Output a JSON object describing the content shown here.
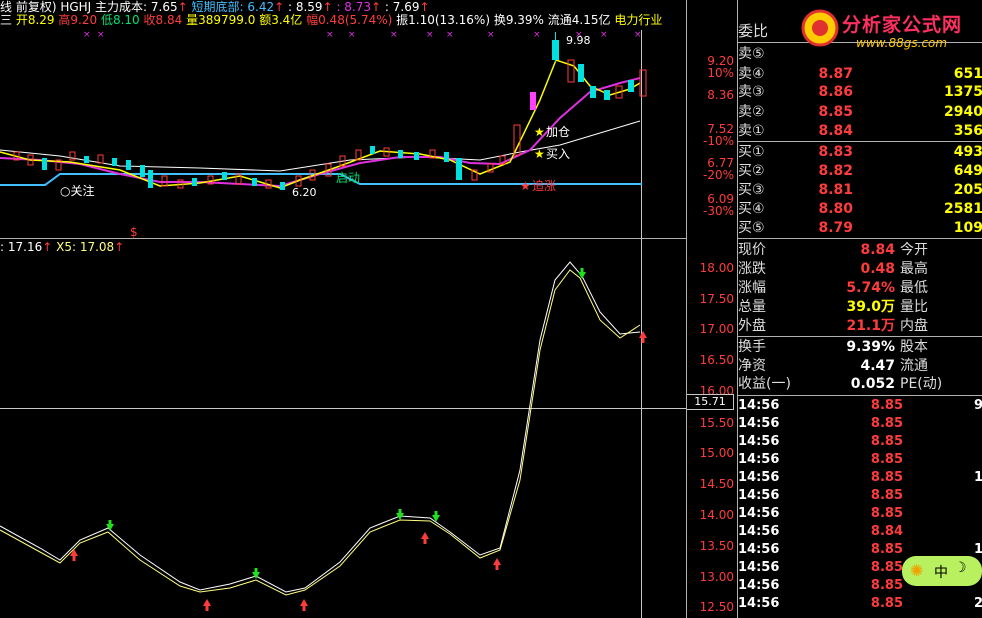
{
  "header": {
    "line1": {
      "mode": "线 前复权)",
      "code": "HGHJ",
      "cost_label": "主力成本: 7.65",
      "cost_arrow": "↑",
      "bottom_label": "短期底部: 6.42",
      "bottom_arrow": "↑",
      "v1": ": 8.59",
      "v1_arrow": "↑",
      "v2": ": 8.73",
      "v2_arrow": "↑",
      "v3": ": 7.69",
      "v3_arrow": "↑"
    },
    "line2": {
      "prefix": "三",
      "open": "开8.29",
      "high": "高9.20",
      "low": "低8.10",
      "close": "收8.84",
      "volume": "量389799.0",
      "amount": "额3.4亿",
      "change": "幅0.48(5.74%)",
      "amplitude": "振1.10(13.16%)",
      "turnover": "换9.39%",
      "float": "流通4.15亿",
      "industry": "电力行业"
    }
  },
  "kline": {
    "price_axis": [
      "9.20",
      "10%",
      "8.36",
      "7.52",
      "-10%",
      "6.77",
      "-20%",
      "6.09",
      "-30%"
    ],
    "annotations": {
      "high_label": "9.98",
      "low_label": "6.20",
      "follow": "○关注",
      "start": "启动",
      "add_pos": "加仓",
      "buy": "买入",
      "chase": "追涨",
      "dollar": "$"
    }
  },
  "indicator": {
    "header_a": ": 17.16",
    "header_a_arrow": "↑",
    "header_b": "X5: 17.08",
    "header_b_arrow": "↑",
    "axis": [
      "18.00",
      "17.50",
      "17.00",
      "16.50",
      "16.00",
      "15.71",
      "15.50",
      "15.00",
      "14.50",
      "14.00",
      "13.50",
      "13.00",
      "12.50"
    ]
  },
  "orderbook": {
    "title": "委比",
    "asks": [
      {
        "label": "卖⑤",
        "price": "",
        "vol": ""
      },
      {
        "label": "卖④",
        "price": "8.87",
        "vol": "651"
      },
      {
        "label": "卖③",
        "price": "8.86",
        "vol": "1375"
      },
      {
        "label": "卖②",
        "price": "8.85",
        "vol": "2940"
      },
      {
        "label": "卖①",
        "price": "8.84",
        "vol": "356"
      }
    ],
    "bids": [
      {
        "label": "买①",
        "price": "8.83",
        "vol": "493"
      },
      {
        "label": "买②",
        "price": "8.82",
        "vol": "649"
      },
      {
        "label": "买③",
        "price": "8.81",
        "vol": "205"
      },
      {
        "label": "买④",
        "price": "8.80",
        "vol": "2581"
      },
      {
        "label": "买⑤",
        "price": "8.79",
        "vol": "109"
      }
    ]
  },
  "stats": [
    {
      "l1": "现价",
      "v1": "8.84",
      "l2": "今开",
      "color": "#ff3c3c"
    },
    {
      "l1": "涨跌",
      "v1": "0.48",
      "l2": "最高",
      "color": "#ff3c3c"
    },
    {
      "l1": "涨幅",
      "v1": "5.74%",
      "l2": "最低",
      "color": "#ff3c3c"
    },
    {
      "l1": "总量",
      "v1": "39.0万",
      "l2": "量比",
      "color": "#ffff00"
    },
    {
      "l1": "外盘",
      "v1": "21.1万",
      "l2": "内盘",
      "color": "#ff3c3c"
    },
    {
      "l1": "换手",
      "v1": "9.39%",
      "l2": "股本",
      "color": "#ffffff"
    },
    {
      "l1": "净资",
      "v1": "4.47",
      "l2": "流通",
      "color": "#ffffff"
    },
    {
      "l1": "收益(一)",
      "v1": "0.052",
      "l2": "PE(动)",
      "color": "#ffffff"
    }
  ],
  "ticks": [
    {
      "time": "14:56",
      "price": "8.85",
      "vol": "9"
    },
    {
      "time": "14:56",
      "price": "8.85",
      "vol": ""
    },
    {
      "time": "14:56",
      "price": "8.85",
      "vol": ""
    },
    {
      "time": "14:56",
      "price": "8.85",
      "vol": ""
    },
    {
      "time": "14:56",
      "price": "8.85",
      "vol": "1"
    },
    {
      "time": "14:56",
      "price": "8.85",
      "vol": ""
    },
    {
      "time": "14:56",
      "price": "8.85",
      "vol": ""
    },
    {
      "time": "14:56",
      "price": "8.84",
      "vol": ""
    },
    {
      "time": "14:56",
      "price": "8.85",
      "vol": "1"
    },
    {
      "time": "14:56",
      "price": "8.85",
      "vol": ""
    },
    {
      "time": "14:56",
      "price": "8.85",
      "vol": ""
    },
    {
      "time": "14:56",
      "price": "8.85",
      "vol": "2"
    }
  ],
  "logo": {
    "text": "分析家公式网",
    "url": "www.88gs.com"
  },
  "bubble": {
    "text": "中"
  },
  "colors": {
    "up": "#ff3c3c",
    "down": "#00e0e0",
    "ma_yellow": "#ffff00",
    "ma_magenta": "#e030e0",
    "ma_white": "#ffffff",
    "ma_cyan": "#40c0ff"
  }
}
